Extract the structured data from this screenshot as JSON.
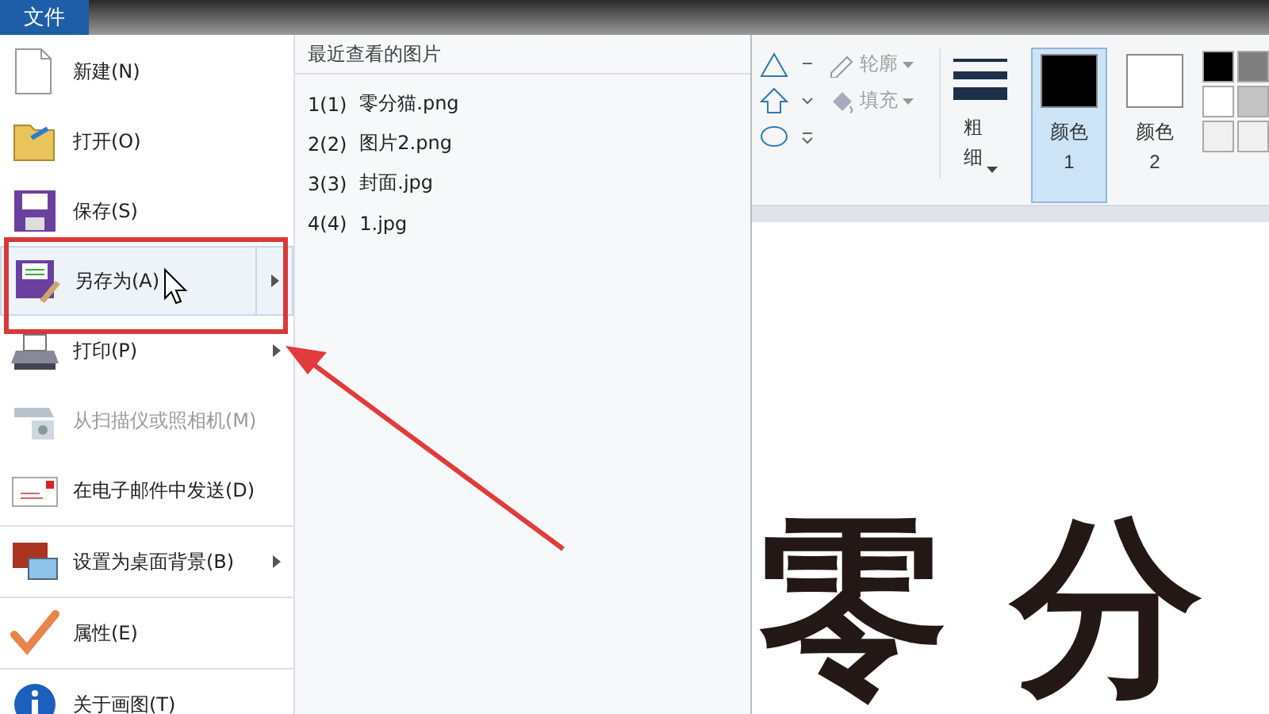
{
  "file_tab": {
    "label": "文件",
    "selected": true
  },
  "menu": {
    "items": [
      {
        "label": "新建(N)",
        "selected": false,
        "submenu": false,
        "disabled": false,
        "separator_after": false
      },
      {
        "label": "打开(O)",
        "selected": false,
        "submenu": false,
        "disabled": false,
        "separator_after": false
      },
      {
        "label": "保存(S)",
        "selected": false,
        "submenu": false,
        "disabled": false,
        "separator_after": false
      },
      {
        "label": "另存为(A)",
        "selected": true,
        "submenu": true,
        "disabled": false,
        "separator_after": false
      },
      {
        "label": "打印(P)",
        "selected": false,
        "submenu": true,
        "disabled": false,
        "separator_after": false
      },
      {
        "label": "从扫描仪或照相机(M)",
        "selected": false,
        "submenu": false,
        "disabled": true,
        "separator_after": false
      },
      {
        "label": "在电子邮件中发送(D)",
        "selected": false,
        "submenu": false,
        "disabled": false,
        "separator_after": true
      },
      {
        "label": "设置为桌面背景(B)",
        "selected": false,
        "submenu": true,
        "disabled": false,
        "separator_after": true
      },
      {
        "label": "属性(E)",
        "selected": false,
        "submenu": false,
        "disabled": false,
        "separator_after": true
      },
      {
        "label": "关于画图(T)",
        "selected": false,
        "submenu": false,
        "disabled": false,
        "separator_after": false
      }
    ]
  },
  "recent": {
    "title": "最近查看的图片",
    "items": [
      {
        "number": "1(1)",
        "name": "零分猫.png"
      },
      {
        "number": "2(2)",
        "name": "图片2.png"
      },
      {
        "number": "3(3)",
        "name": "封面.jpg"
      },
      {
        "number": "4(4)",
        "name": "1.jpg"
      }
    ]
  },
  "ribbon": {
    "outline": {
      "label": "轮廓",
      "disabled": true
    },
    "fill": {
      "label": "填充",
      "disabled": true
    },
    "size": {
      "label": "粗细"
    },
    "colors": [
      {
        "label": "颜色 1",
        "selected": true,
        "color": "#000000"
      },
      {
        "label": "颜色 2",
        "selected": false,
        "color": "#ffffff"
      }
    ],
    "palette": [
      {
        "color": "#000000"
      },
      {
        "color": "#7f7f7f"
      },
      {
        "color": "#ffffff"
      },
      {
        "color": "#c3c3c3"
      },
      {
        "color": "#f0f0f0"
      },
      {
        "color": "#f0f0f0"
      }
    ]
  },
  "canvas": {
    "characters": [
      "零",
      "分"
    ]
  }
}
